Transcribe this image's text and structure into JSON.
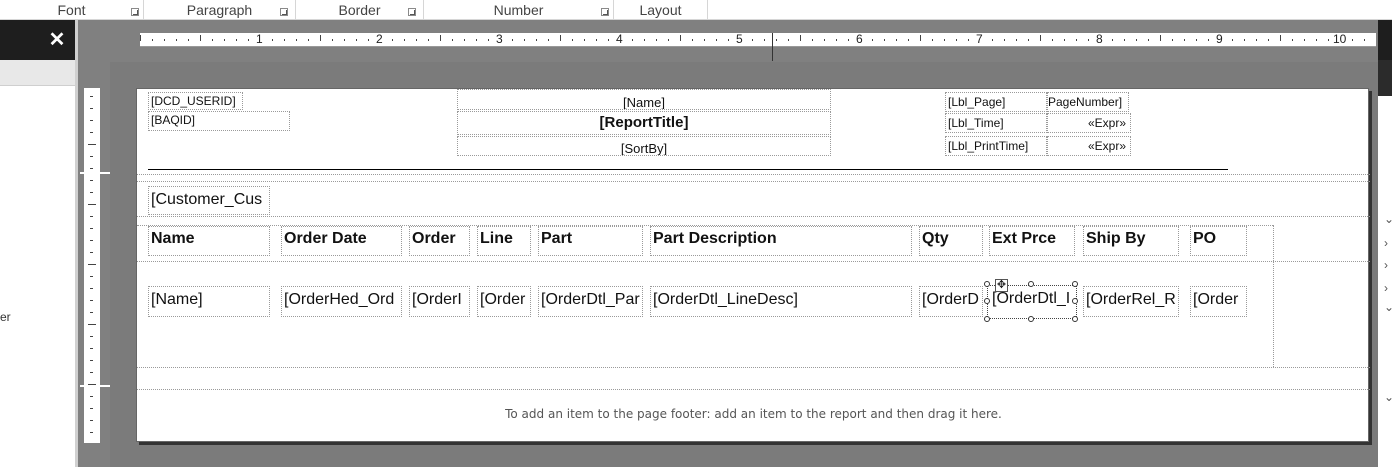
{
  "ribbon": {
    "groups": [
      {
        "label": "Font"
      },
      {
        "label": "Paragraph"
      },
      {
        "label": "Border"
      },
      {
        "label": "Number"
      },
      {
        "label": "Layout"
      }
    ]
  },
  "left_panel": {
    "close_glyph": "✕",
    "partial_text": "er"
  },
  "ruler": {
    "numbers": [
      "1",
      "2",
      "3",
      "4",
      "5",
      "6",
      "7",
      "8",
      "9",
      "10"
    ]
  },
  "report": {
    "page_header": {
      "dcd_userid": "[DCD_USERID]",
      "baqid": "[BAQID]",
      "name": "[Name]",
      "report_title": "[ReportTitle]",
      "sort_by": "[SortBy]",
      "lbl_page": "[Lbl_Page]",
      "page_number": "PageNumber]",
      "lbl_time": "[Lbl_Time]",
      "expr_time": "«Expr»",
      "lbl_print_time": "[Lbl_PrintTime]",
      "expr_print_time": "«Expr»"
    },
    "group_header": {
      "customer": "[Customer_Cus"
    },
    "columns": [
      {
        "header": "Name",
        "field": "[Name]"
      },
      {
        "header": "Order Date",
        "field": "[OrderHed_Ord"
      },
      {
        "header": "Order",
        "field": "[OrderI"
      },
      {
        "header": "Line",
        "field": "[Order"
      },
      {
        "header": "Part",
        "field": "[OrderDtl_Par"
      },
      {
        "header": "Part Description",
        "field": "[OrderDtl_LineDesc]"
      },
      {
        "header": "Qty",
        "field": "[OrderD"
      },
      {
        "header": "Ext Prce",
        "field": "[OrderDtl_I"
      },
      {
        "header": "Ship By",
        "field": "[OrderRel_R"
      },
      {
        "header": "PO",
        "field": "[Order"
      }
    ],
    "page_footer_hint": "To add an item to the page footer: add an item to the report and then drag it here."
  }
}
